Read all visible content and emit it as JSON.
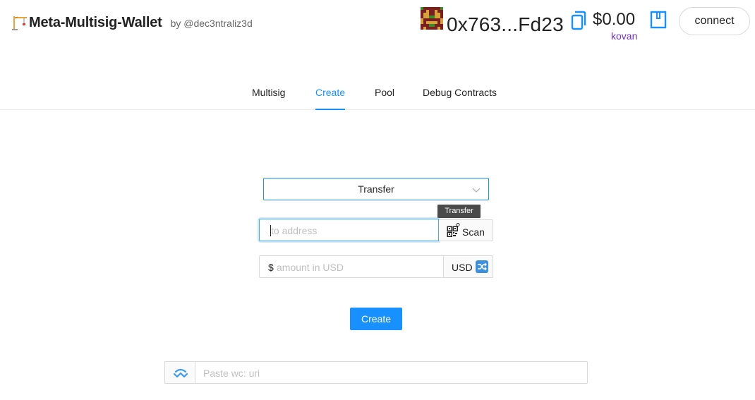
{
  "header": {
    "brand_emoji": "🏗",
    "title": "Meta-Multisig-Wallet",
    "byline": "by @dec3ntraliz3d"
  },
  "account": {
    "address": "0x763...Fd23",
    "balance": "$0.00",
    "network": "kovan",
    "connect_label": "connect",
    "icons": [
      "blockie-avatar-icon",
      "copy-icon",
      "wallet-icon"
    ]
  },
  "tabs": [
    {
      "label": "Multisig",
      "active": false
    },
    {
      "label": "Create",
      "active": true
    },
    {
      "label": "Pool",
      "active": false
    },
    {
      "label": "Debug Contracts",
      "active": false
    }
  ],
  "form": {
    "method_select_value": "Transfer",
    "tooltip": "Transfer",
    "to_address_placeholder": "to address",
    "scan_label": "Scan",
    "amount_prefix": "$",
    "amount_placeholder": "amount in USD",
    "currency_label": "USD",
    "create_label": "Create"
  },
  "walletconnect": {
    "placeholder": "Paste wc: uri",
    "icon": "walletconnect-icon"
  },
  "colors": {
    "accent": "#1890ff",
    "network": "#722ed1",
    "text": "#222222"
  }
}
